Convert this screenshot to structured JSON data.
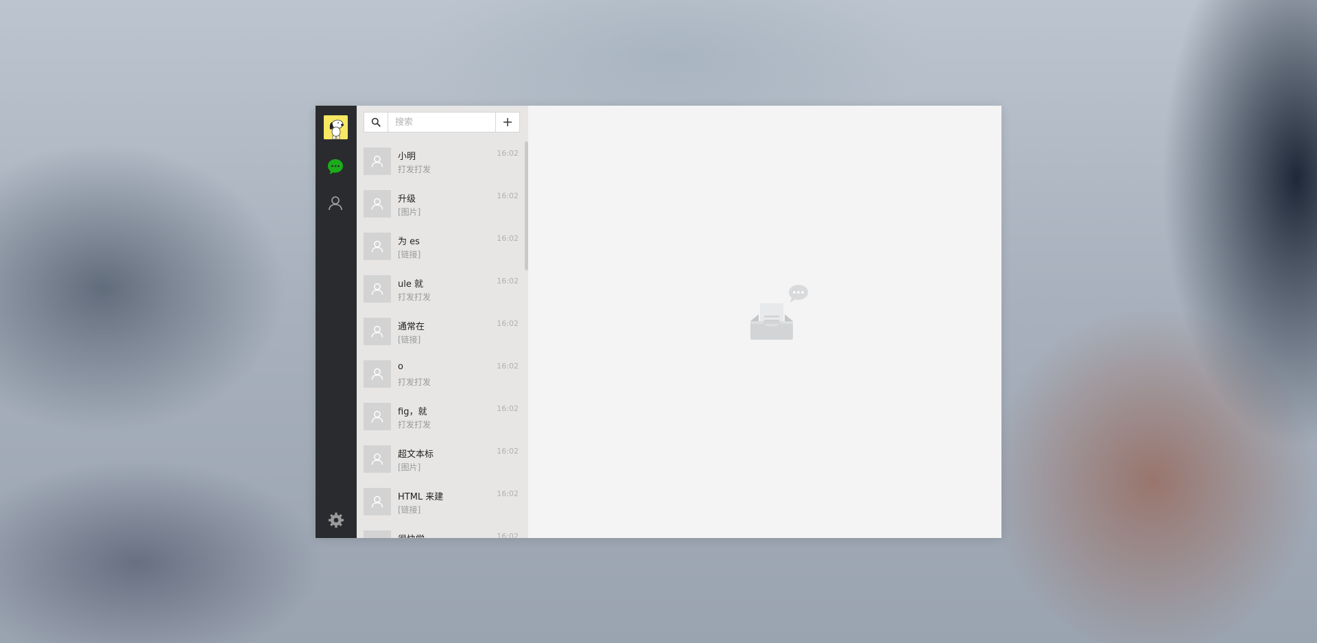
{
  "nav": {
    "avatar_icon": "snoopy-avatar",
    "chat_icon": "chat-bubble-icon",
    "contacts_icon": "person-icon",
    "settings_icon": "gear-icon",
    "accent_color": "#1aad19"
  },
  "search": {
    "placeholder": "搜索",
    "value": "",
    "search_icon": "search-icon",
    "add_icon": "plus-icon"
  },
  "conversations": [
    {
      "name": "小明",
      "preview": "打发打发",
      "time": "16:02"
    },
    {
      "name": "升级",
      "preview": "[图片]",
      "time": "16:02"
    },
    {
      "name": "为 es",
      "preview": "[链接]",
      "time": "16:02"
    },
    {
      "name": "ule 就",
      "preview": "打发打发",
      "time": "16:02"
    },
    {
      "name": "通常在",
      "preview": "[链接]",
      "time": "16:02"
    },
    {
      "name": "o",
      "preview": "打发打发",
      "time": "16:02"
    },
    {
      "name": "fig，就",
      "preview": "打发打发",
      "time": "16:02"
    },
    {
      "name": "超文本标",
      "preview": "[图片]",
      "time": "16:02"
    },
    {
      "name": "HTML 来建",
      "preview": "[链接]",
      "time": "16:02"
    },
    {
      "name": "很快学",
      "preview": "",
      "time": "16:02"
    }
  ],
  "main": {
    "empty_state_icon": "empty-inbox-icon"
  }
}
